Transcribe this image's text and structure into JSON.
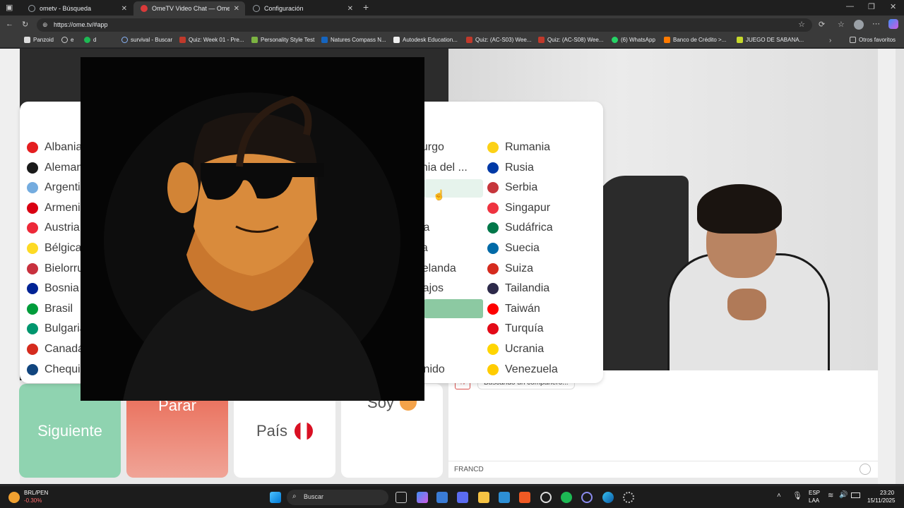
{
  "tabs": [
    {
      "title": "ometv - Búsqueda",
      "icon": "search-tab-icon",
      "active": false
    },
    {
      "title": "OmeTV Video Chat — Omeg",
      "icon": "ometv-tab-icon",
      "active": true
    },
    {
      "title": "Configuración",
      "icon": "gear-icon",
      "active": false
    }
  ],
  "address": {
    "url": "https://ome.tv/#app"
  },
  "bookmarks": [
    "Panzoid",
    "e",
    "d",
    "survival - Buscar",
    "Quiz: Week 01 - Pre...",
    "Personality Style Test",
    "Natures Compass N...",
    "Autodesk Education...",
    "Quiz: (AC-S03) Wee...",
    "Quiz: (AC-S08) Wee...",
    "(6) WhatsApp",
    "Banco de Crédito >...",
    "JUEGO DE SABANA..."
  ],
  "bookmarks_other": "Otros favoritos",
  "countries": {
    "col1": [
      "Albania",
      "Alemania",
      "Argentina",
      "Armenia",
      "Austria",
      "Bélgica",
      "Bielorrusia",
      "Bosnia",
      "Brasil",
      "Bulgaria",
      "Canadá",
      "Chequia"
    ],
    "col2": [
      "burgo",
      "onia del ...",
      "a",
      "",
      "via",
      "ga",
      "Zelanda",
      "Bajos",
      "",
      "a",
      "al",
      "Unido"
    ],
    "col3": [
      "Rumania",
      "Rusia",
      "Serbia",
      "Singapur",
      "Sudáfrica",
      "Suecia",
      "Suiza",
      "Tailandia",
      "Taiwán",
      "Turquía",
      "Ucrania",
      "Venezuela"
    ]
  },
  "controls": {
    "next": "Siguiente",
    "stop": "Parar",
    "country": "País",
    "gender": "Soy"
  },
  "chat": {
    "status": "Buscando un compañero...",
    "input_value": "FRANCD"
  },
  "taskbar": {
    "stock_name": "BRL/PEN",
    "stock_change": "-0.30%",
    "search": "Buscar",
    "lang_top": "ESP",
    "lang_bottom": "LAA",
    "time": "23:20",
    "date": "15/11/2025"
  },
  "colors": {
    "next": "#8fd3b0",
    "stop": "#e8705e",
    "highlight": "#c8e6d4",
    "selected": "#8cc9a2"
  }
}
